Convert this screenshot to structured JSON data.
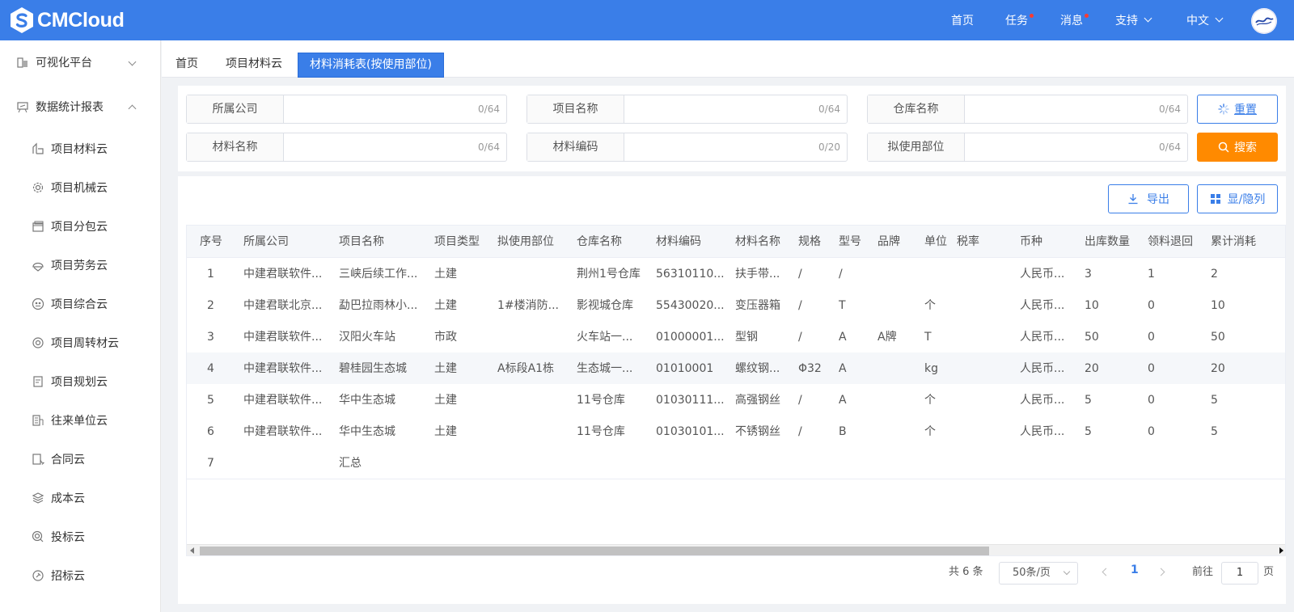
{
  "app": {
    "logo_text": "CMCloud"
  },
  "topnav": {
    "home": "首页",
    "tasks": "任务",
    "messages": "消息",
    "support": "支持",
    "language": "中文"
  },
  "sidebar": {
    "groups": [
      {
        "label": "可视化平台",
        "icon": "building-icon",
        "expanded": false
      },
      {
        "label": "数据统计报表",
        "icon": "report-icon",
        "expanded": true
      }
    ],
    "items": [
      {
        "label": "项目材料云",
        "icon": "material-icon"
      },
      {
        "label": "项目机械云",
        "icon": "gear-icon"
      },
      {
        "label": "项目分包云",
        "icon": "package-icon"
      },
      {
        "label": "项目劳务云",
        "icon": "helmet-icon"
      },
      {
        "label": "项目综合云",
        "icon": "grid-circle-icon"
      },
      {
        "label": "项目周转材云",
        "icon": "cycle-icon"
      },
      {
        "label": "项目规划云",
        "icon": "document-icon"
      },
      {
        "label": "往来单位云",
        "icon": "building-list-icon"
      },
      {
        "label": "合同云",
        "icon": "contract-icon"
      },
      {
        "label": "成本云",
        "icon": "layers-icon"
      },
      {
        "label": "投标云",
        "icon": "target-icon"
      },
      {
        "label": "招标云",
        "icon": "bid-icon"
      }
    ]
  },
  "tabs": [
    "首页",
    "项目材料云",
    "材料消耗表(按使用部位)"
  ],
  "filters": [
    {
      "label": "所属公司",
      "value": "",
      "count": "0/64"
    },
    {
      "label": "项目名称",
      "value": "",
      "count": "0/64"
    },
    {
      "label": "仓库名称",
      "value": "",
      "count": "0/64"
    },
    {
      "label": "材料名称",
      "value": "",
      "count": "0/64"
    },
    {
      "label": "材料编码",
      "value": "",
      "count": "0/20"
    },
    {
      "label": "拟使用部位",
      "value": "",
      "count": "0/64"
    }
  ],
  "buttons": {
    "reset": "重置",
    "search": "搜索",
    "export": "导出",
    "columns": "显/隐列"
  },
  "colors": {
    "primary": "#3a7ee8",
    "search": "#ff8a00",
    "badge": "#ff3b30"
  },
  "table": {
    "headers": [
      "序号",
      "所属公司",
      "项目名称",
      "项目类型",
      "拟使用部位",
      "仓库名称",
      "材料编码",
      "材料名称",
      "规格",
      "型号",
      "品牌",
      "单位",
      "税率",
      "币种",
      "出库数量",
      "领料退回",
      "累计消耗"
    ],
    "rows": [
      [
        "1",
        "中建君联软件...",
        "三峡后续工作...",
        "土建",
        "",
        "荆州1号仓库",
        "56310110...",
        "扶手带...",
        "/",
        "/",
        "",
        "",
        "",
        "人民币...",
        "3",
        "1",
        "2"
      ],
      [
        "2",
        "中建君联北京...",
        "勐巴拉雨林小...",
        "土建",
        "1#楼消防...",
        "影视城仓库",
        "55430020...",
        "变压器箱",
        "/",
        "T",
        "",
        "个",
        "",
        "人民币...",
        "10",
        "0",
        "10"
      ],
      [
        "3",
        "中建君联软件...",
        "汉阳火车站",
        "市政",
        "",
        "火车站一...",
        "01000001...",
        "型钢",
        "/",
        "A",
        "A牌",
        "T",
        "",
        "人民币...",
        "50",
        "0",
        "50"
      ],
      [
        "4",
        "中建君联软件...",
        "碧桂园生态城",
        "土建",
        "A标段A1栋",
        "生态城一...",
        "01010001",
        "螺纹钢...",
        "Φ32",
        "A",
        "",
        "kg",
        "",
        "人民币...",
        "20",
        "0",
        "20"
      ],
      [
        "5",
        "中建君联软件...",
        "华中生态城",
        "土建",
        "",
        "11号仓库",
        "01030111...",
        "高强钢丝",
        "/",
        "A",
        "",
        "个",
        "",
        "人民币...",
        "5",
        "0",
        "5"
      ],
      [
        "6",
        "中建君联软件...",
        "华中生态城",
        "土建",
        "",
        "11号仓库",
        "01030101...",
        "不锈钢丝",
        "/",
        "B",
        "",
        "个",
        "",
        "人民币...",
        "5",
        "0",
        "5"
      ],
      [
        "7",
        "",
        "汇总",
        "",
        "",
        "",
        "",
        "",
        "",
        "",
        "",
        "",
        "",
        "",
        "",
        "",
        ""
      ]
    ],
    "highlighted_row": 3
  },
  "pagination": {
    "total": "共 6 条",
    "page_size": "50条/页",
    "current_page": "1",
    "goto_prefix": "前往",
    "goto_value": "1",
    "goto_suffix": "页"
  }
}
